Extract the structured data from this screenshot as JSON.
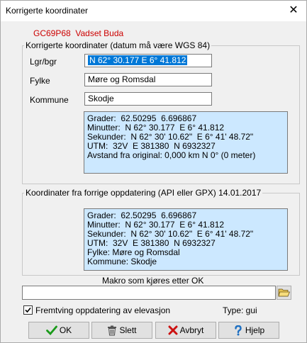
{
  "window": {
    "title": "Korrigerte koordinater",
    "close_symbol": "✕"
  },
  "cache": {
    "code": "GC69P68",
    "name": "Vadset Buda"
  },
  "corrected": {
    "legend": "Korrigerte koordinater (datum må være WGS 84)",
    "lgr_label": "Lgr/bgr",
    "lgr_value": "N 62° 30.177 E 6° 41.812",
    "fylke_label": "Fylke",
    "fylke_value": "Møre og Romsdal",
    "kommune_label": "Kommune",
    "kommune_value": "Skodje",
    "info_lines": [
      "Grader:  62.50295  6.696867",
      "Minutter:  N 62° 30.177  E 6° 41.812",
      "Sekunder:  N 62° 30' 10.62\"  E 6° 41' 48.72\"",
      "UTM:  32V  E 381380  N 6932327",
      "Avstand fra original: 0,000 km N 0° (0 meter)"
    ]
  },
  "previous": {
    "legend": "Koordinater fra forrige oppdatering (API eller GPX) 14.01.2017",
    "info_lines": [
      "Grader:  62.50295  6.696867",
      "Minutter:  N 62° 30.177  E 6° 41.812",
      "Sekunder:  N 62° 30' 10.62\"  E 6° 41' 48.72\"",
      "UTM:  32V  E 381380  N 6932327",
      "Fylke: Møre og Romsdal",
      "Kommune: Skodje"
    ]
  },
  "macro": {
    "label": "Makro som kjøres etter OK",
    "value": ""
  },
  "force_elevation": {
    "label": "Fremtving oppdatering av elevasjon",
    "checked": true
  },
  "type_label": "Type: gui",
  "buttons": {
    "ok": "OK",
    "delete": "Slett",
    "cancel": "Avbryt",
    "help": "Hjelp"
  },
  "colors": {
    "selection": "#0078d7",
    "info_bg": "#cce8ff",
    "cache_code": "#cc0000",
    "ok_check": "#1a9a1a",
    "cancel_x": "#cc1111"
  }
}
